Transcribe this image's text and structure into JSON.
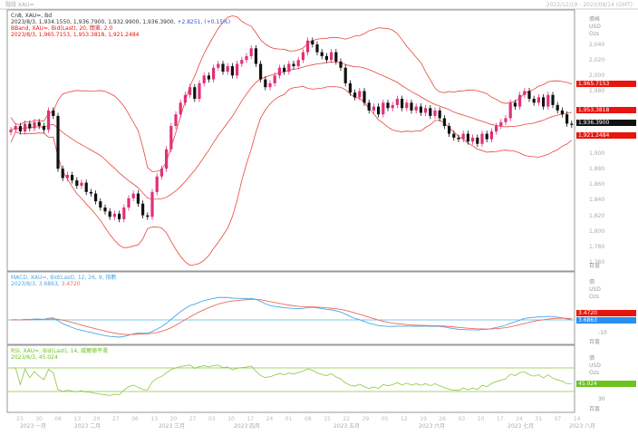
{
  "header": {
    "title": "階段 XAU=",
    "range": "2022/12/19 - 2023/08/14 (GMT)"
  },
  "legend": {
    "price_title": "Cn8, XAU=, Bd",
    "price_values": "2023/8/3, 1,934.1550, 1,936.7900, 1,932.9900, 1,936.3900,",
    "price_change": "+2.8251, (+0.15%)",
    "bband_title": "BBand, XAU=, Bid(Last), 20, 簡單, 2.0",
    "bband_values": "2023/8/3, 1,965.7153, 1,953.3818, 1,921.2484",
    "macd_title": "MACD, XAU=, Bid(Last), 12, 26, 9, 指數",
    "macd_values_a": "2023/8/3, 3.6863,",
    "macd_values_b": "3.4720",
    "rsi_title": "RSI, XAU=, Bid(Last), 14, 威爾德平滑",
    "rsi_values": "2023/8/3, 45.024"
  },
  "axis": {
    "price_unit": [
      "價格",
      "USD",
      "Ozs"
    ],
    "price_ticks": [
      "2,040",
      "2,020",
      "2,000",
      "1,980",
      "1,900",
      "1,880",
      "1,860",
      "1,840",
      "1,820",
      "1,800",
      "1,780",
      "1,760"
    ],
    "macd_unit": [
      "價",
      "USD",
      "Ozs"
    ],
    "macd_ticks": [
      "-10"
    ],
    "rsi_unit": [
      "價",
      "USD",
      "Ozs"
    ],
    "rsi_ticks": [
      "30"
    ],
    "panel_footer": "百盎",
    "tags": {
      "bb_upper": "1,965.7153",
      "bb_mid": "1,953.3818",
      "last": "1,936.3900",
      "bb_lower": "1,921.2484",
      "macd_signal": "3.4720",
      "macd": "3.6863",
      "rsi": "45.024"
    },
    "day_ticks": [
      "23",
      "30",
      "06",
      "13",
      "20",
      "27",
      "06",
      "13",
      "20",
      "27",
      "03",
      "10",
      "17",
      "24",
      "01",
      "08",
      "15",
      "22",
      "29",
      "05",
      "12",
      "19",
      "26",
      "03",
      "10",
      "17",
      "24",
      "31",
      "07",
      "14"
    ],
    "month_ticks": [
      "2023 一月",
      "2023 二月",
      "2023 三月",
      "2023 四月",
      "2023 五月",
      "2023 六月",
      "2023 七月",
      "2023 八月"
    ]
  },
  "colors": {
    "up": "#e0307a",
    "down": "#111111",
    "bband": "#e8453c",
    "macd": "#4aa8e8",
    "signal": "#ef6b5a",
    "rsi": "#8cc63f",
    "tag_red": "#e8150c",
    "tag_blue": "#2a8ff0",
    "tag_green": "#6cc21f"
  },
  "chart_data": [
    {
      "type": "candlestick",
      "title": "XAU=",
      "ylim": [
        1760,
        2076
      ],
      "bollinger": {
        "period": 20,
        "std": 2
      },
      "closes": [
        1930,
        1935,
        1928,
        1938,
        1932,
        1940,
        1935,
        1930,
        1955,
        1948,
        1880,
        1868,
        1872,
        1865,
        1858,
        1862,
        1850,
        1848,
        1838,
        1830,
        1825,
        1818,
        1822,
        1815,
        1830,
        1842,
        1848,
        1835,
        1820,
        1818,
        1850,
        1870,
        1880,
        1905,
        1935,
        1950,
        1965,
        1975,
        1985,
        1970,
        1990,
        2000,
        1995,
        2010,
        2015,
        2005,
        2012,
        2000,
        2015,
        2020,
        2025,
        2035,
        2015,
        1995,
        1985,
        1990,
        2000,
        2010,
        2005,
        2015,
        2012,
        2020,
        2030,
        2045,
        2040,
        2030,
        2025,
        2020,
        2030,
        2018,
        2010,
        1990,
        1978,
        1972,
        1980,
        1965,
        1955,
        1960,
        1950,
        1965,
        1958,
        1962,
        1970,
        1958,
        1965,
        1955,
        1960,
        1952,
        1958,
        1948,
        1955,
        1945,
        1935,
        1925,
        1920,
        1918,
        1925,
        1915,
        1920,
        1912,
        1925,
        1918,
        1928,
        1935,
        1940,
        1945,
        1965,
        1960,
        1975,
        1980,
        1970,
        1965,
        1972,
        1960,
        1975,
        1962,
        1955,
        1950,
        1938,
        1936.39
      ]
    },
    {
      "type": "line",
      "title": "MACD",
      "params": [
        12,
        26,
        9
      ]
    },
    {
      "type": "line",
      "title": "RSI",
      "period": 14,
      "levels": [
        70,
        30
      ]
    }
  ]
}
